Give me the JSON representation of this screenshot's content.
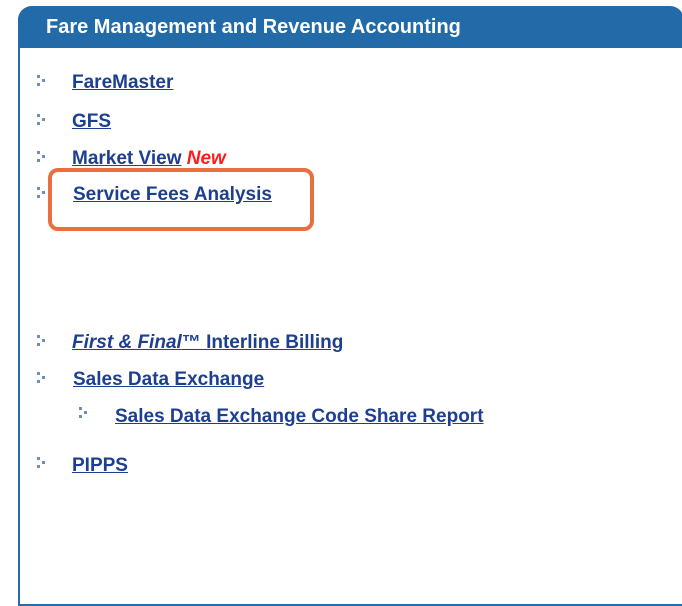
{
  "panel": {
    "title": "Fare Management and Revenue Accounting"
  },
  "links": {
    "faremaster": "FareMaster",
    "gfs": "GFS",
    "market_view": "Market View",
    "market_view_badge": "New",
    "service_fees": "Service Fees Analysis",
    "first_final_italic": "First & Final",
    "first_final_rest": "™ Interline Billing",
    "sales_data": "Sales Data Exchange",
    "sales_data_code_share": "Sales Data Exchange Code Share Report",
    "pipps": "PIPPS"
  },
  "colors": {
    "header_bg": "#236aa8",
    "link": "#1d3f8f",
    "new_badge": "#ff1b1b",
    "highlight": "#ea6f3f"
  },
  "icons": {
    "bullet": "dotted-arrow-bullet-icon"
  }
}
